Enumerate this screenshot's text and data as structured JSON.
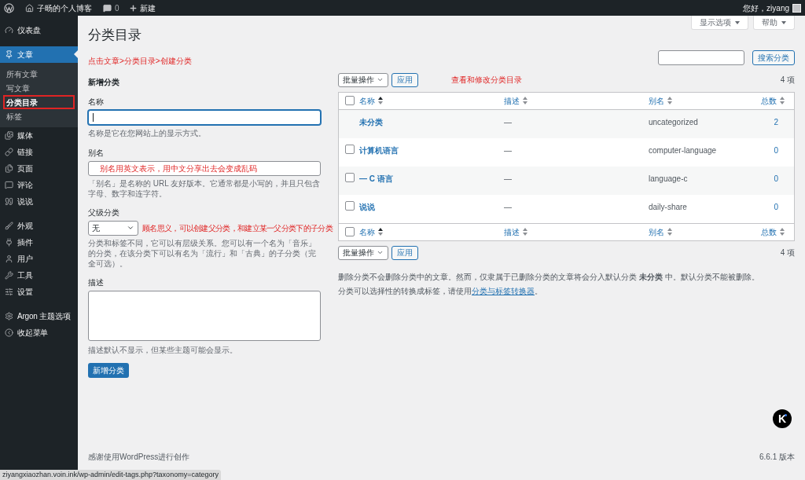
{
  "admin_bar": {
    "site_name": "子旸的个人博客",
    "comment_count": "0",
    "new_label": "新建",
    "greeting": "您好，ziyang"
  },
  "sidebar": {
    "groups": [
      {
        "items": [
          {
            "label": "仪表盘",
            "selected": false
          }
        ]
      },
      {
        "items": [
          {
            "label": "文章",
            "selected": true,
            "children": [
              {
                "label": "所有文章",
                "selected": false,
                "highlighted": false
              },
              {
                "label": "写文章",
                "selected": false,
                "highlighted": false
              },
              {
                "label": "分类目录",
                "selected": true,
                "highlighted": true
              },
              {
                "label": "标签",
                "selected": false,
                "highlighted": false
              }
            ]
          },
          {
            "label": "媒体",
            "selected": false
          },
          {
            "label": "链接",
            "selected": false
          },
          {
            "label": "页面",
            "selected": false
          },
          {
            "label": "评论",
            "selected": false
          },
          {
            "label": "说说",
            "selected": false
          }
        ]
      },
      {
        "items": [
          {
            "label": "外观",
            "selected": false
          },
          {
            "label": "插件",
            "selected": false
          },
          {
            "label": "用户",
            "selected": false
          },
          {
            "label": "工具",
            "selected": false
          },
          {
            "label": "设置",
            "selected": false
          }
        ]
      },
      {
        "items": [
          {
            "label": "Argon 主题选项",
            "selected": false
          },
          {
            "label": "收起菜单",
            "selected": false
          }
        ]
      }
    ]
  },
  "screen_meta": [
    "显示选项",
    "帮助"
  ],
  "page_title": "分类目录",
  "annotation_top": "点击文章>分类目录>创建分类",
  "search": {
    "button": "搜索分类"
  },
  "form": {
    "heading": "新增分类",
    "name_field": {
      "label": "名称",
      "hint": "名称是它在您网站上的显示方式。",
      "focused": true
    },
    "slug_field": {
      "label": "别名",
      "value": "别名用英文表示，用中文分享出去会变成乱码",
      "hint": "「别名」是名称的 URL 友好版本。它通常都是小写的，并且只包含字母、数字和连字符。"
    },
    "parent_field": {
      "label": "父级分类",
      "value": "无",
      "annotation": "顾名思义，可以创建父分类，和建立某一父分类下的子分类",
      "hint": "分类和标签不同，它可以有层级关系。您可以有一个名为「音乐」的分类，在该分类下可以有名为「流行」和「古典」的子分类（完全可选）。"
    },
    "description_field": {
      "label": "描述",
      "hint": "描述默认不显示，但某些主题可能会显示。"
    },
    "submit": "新增分类"
  },
  "list": {
    "bulk_action": "批量操作",
    "apply": "应用",
    "annotation": "查看和修改分类目录",
    "item_count": "4 项",
    "header_checked": false,
    "columns": [
      {
        "label": "名称",
        "sorted": true
      },
      {
        "label": "描述",
        "sorted": false
      },
      {
        "label": "别名",
        "sorted": false
      },
      {
        "label": "总数",
        "sorted": false
      }
    ],
    "footer_checked": false,
    "footer_columns": [
      {
        "label": "名称",
        "sorted": true
      },
      {
        "label": "描述",
        "sorted": false
      },
      {
        "label": "别名",
        "sorted": false
      },
      {
        "label": "总数",
        "sorted": false
      }
    ],
    "rows": [
      {
        "name": "未分类",
        "description": "—",
        "slug": "uncategorized",
        "count": "2"
      },
      {
        "name": "计算机语言",
        "description": "—",
        "slug": "computer-language",
        "count": "0",
        "checked": false
      },
      {
        "name": "— C 语言",
        "description": "—",
        "slug": "language-c",
        "count": "0",
        "checked": false
      },
      {
        "name": "说说",
        "description": "—",
        "slug": "daily-share",
        "count": "0",
        "checked": false
      }
    ],
    "bottom_bulk_action": "批量操作",
    "bottom_apply": "应用",
    "bottom_item_count": "4 项",
    "notes": [
      "删除分类不会删除分类中的文章。然而，仅隶属于已删除分类的文章将会分入默认分类 **未分类** 中。默认分类不能被删除。"
    ],
    "convert_note": "分类可以选择性的转换成标签，请使用",
    "convert_link": "分类与标签转换器",
    "convert_end": "。"
  },
  "floating_button": "K",
  "footer": {
    "thanks": "感谢使用WordPress进行创作",
    "version": "6.6.1 版本"
  },
  "status_url": "ziyangxiaozhan.voin.ink/wp-admin/edit-tags.php?taxonomy=category"
}
